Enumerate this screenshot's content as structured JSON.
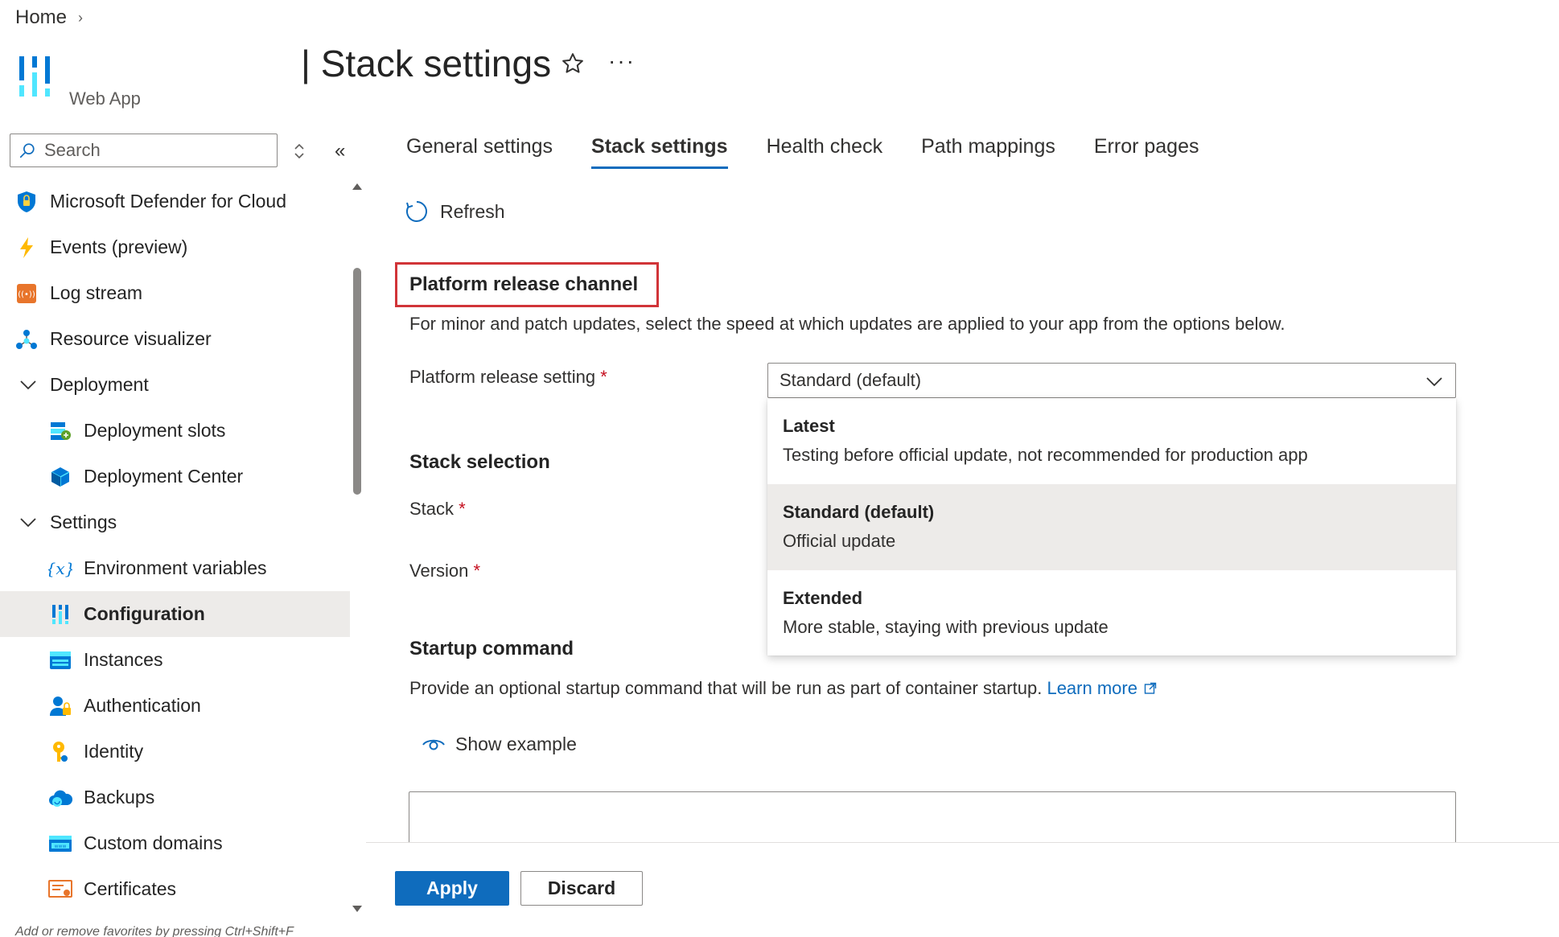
{
  "breadcrumb": {
    "home": "Home"
  },
  "header": {
    "title": "| Stack settings",
    "resource_type": "Web App",
    "more_label": "···"
  },
  "sidebar": {
    "search_placeholder": "Search",
    "items": [
      {
        "label": "Microsoft Defender for Cloud",
        "icon": "shield-icon"
      },
      {
        "label": "Events (preview)",
        "icon": "lightning-icon"
      },
      {
        "label": "Log stream",
        "icon": "log-stream-icon"
      },
      {
        "label": "Resource visualizer",
        "icon": "resource-visualizer-icon"
      },
      {
        "label": "Deployment",
        "icon": "chevron-down-icon"
      },
      {
        "label": "Deployment slots",
        "icon": "deployment-slots-icon"
      },
      {
        "label": "Deployment Center",
        "icon": "cube-icon"
      },
      {
        "label": "Settings",
        "icon": "chevron-down-icon"
      },
      {
        "label": "Environment variables",
        "icon": "variable-icon"
      },
      {
        "label": "Configuration",
        "icon": "configuration-icon"
      },
      {
        "label": "Instances",
        "icon": "instances-icon"
      },
      {
        "label": "Authentication",
        "icon": "user-lock-icon"
      },
      {
        "label": "Identity",
        "icon": "key-icon"
      },
      {
        "label": "Backups",
        "icon": "cloud-backup-icon"
      },
      {
        "label": "Custom domains",
        "icon": "www-icon"
      },
      {
        "label": "Certificates",
        "icon": "certificate-icon"
      }
    ],
    "footer_hint": "Add or remove favorites by pressing Ctrl+Shift+F"
  },
  "tabs": [
    "General settings",
    "Stack settings",
    "Health check",
    "Path mappings",
    "Error pages"
  ],
  "toolbar": {
    "refresh_label": "Refresh"
  },
  "platform": {
    "section_title": "Platform release channel",
    "description": "For minor and patch updates, select the speed at which updates are applied to your app from the options below.",
    "setting_label": "Platform release setting",
    "required_mark": "*",
    "selected_value": "Standard (default)",
    "options": [
      {
        "title": "Latest",
        "description": "Testing before official update, not recommended for production app"
      },
      {
        "title": "Standard (default)",
        "description": "Official update"
      },
      {
        "title": "Extended",
        "description": "More stable, staying with previous update"
      }
    ]
  },
  "stack": {
    "section_title": "Stack selection",
    "stack_label": "Stack",
    "version_label": "Version"
  },
  "startup": {
    "section_title": "Startup command",
    "description": "Provide an optional startup command that will be run as part of container startup.",
    "learn_more": "Learn more",
    "show_example": "Show example"
  },
  "actions": {
    "apply": "Apply",
    "discard": "Discard"
  },
  "colors": {
    "accent": "#0f6cbd",
    "highlight_border": "#d13438",
    "selected_bg": "#edebe9"
  }
}
